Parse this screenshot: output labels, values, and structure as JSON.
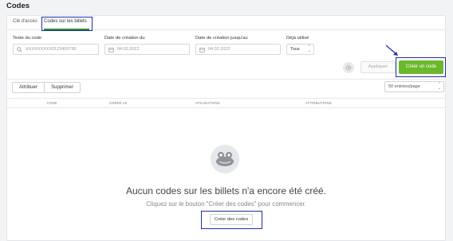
{
  "page": {
    "title": "Codes"
  },
  "tabs": [
    {
      "label": "Clé d'accès"
    },
    {
      "label": "Codes sur les billets"
    }
  ],
  "filters": {
    "text_code": {
      "label": "Texte du code",
      "placeholder": "XXXXXXXXX0123456790"
    },
    "created_from": {
      "label": "Date de création du",
      "placeholder": "04.02.2022"
    },
    "created_to": {
      "label": "Date de création jusqu'au",
      "placeholder": "04.02.2022"
    },
    "already_used": {
      "label": "Déjà utilisé",
      "value": "Tous"
    }
  },
  "actions": {
    "apply_label": "Appliquer",
    "create_label": "Créer un code"
  },
  "toolbar": {
    "assign_label": "Attribuer",
    "delete_label": "Supprimer",
    "per_page": "50 entrées/page"
  },
  "table": {
    "columns": [
      "CODE",
      "CRÉER LE",
      "UTILISATIONS",
      "ATTRIBUTIONS"
    ]
  },
  "empty_state": {
    "title": "Aucun codes sur les billets n'a encore été créé.",
    "subtitle": "Cliquez sur le bouton \"Créer des codes\" pour commencer.",
    "button_label": "Créer des codes"
  },
  "colors": {
    "accent_green": "#6cb82c",
    "highlight_blue": "#1f2fa8"
  },
  "icons": [
    "search-icon",
    "calendar-icon",
    "gear-icon",
    "chevron-icon",
    "frog-icon",
    "arrow-icon"
  ]
}
